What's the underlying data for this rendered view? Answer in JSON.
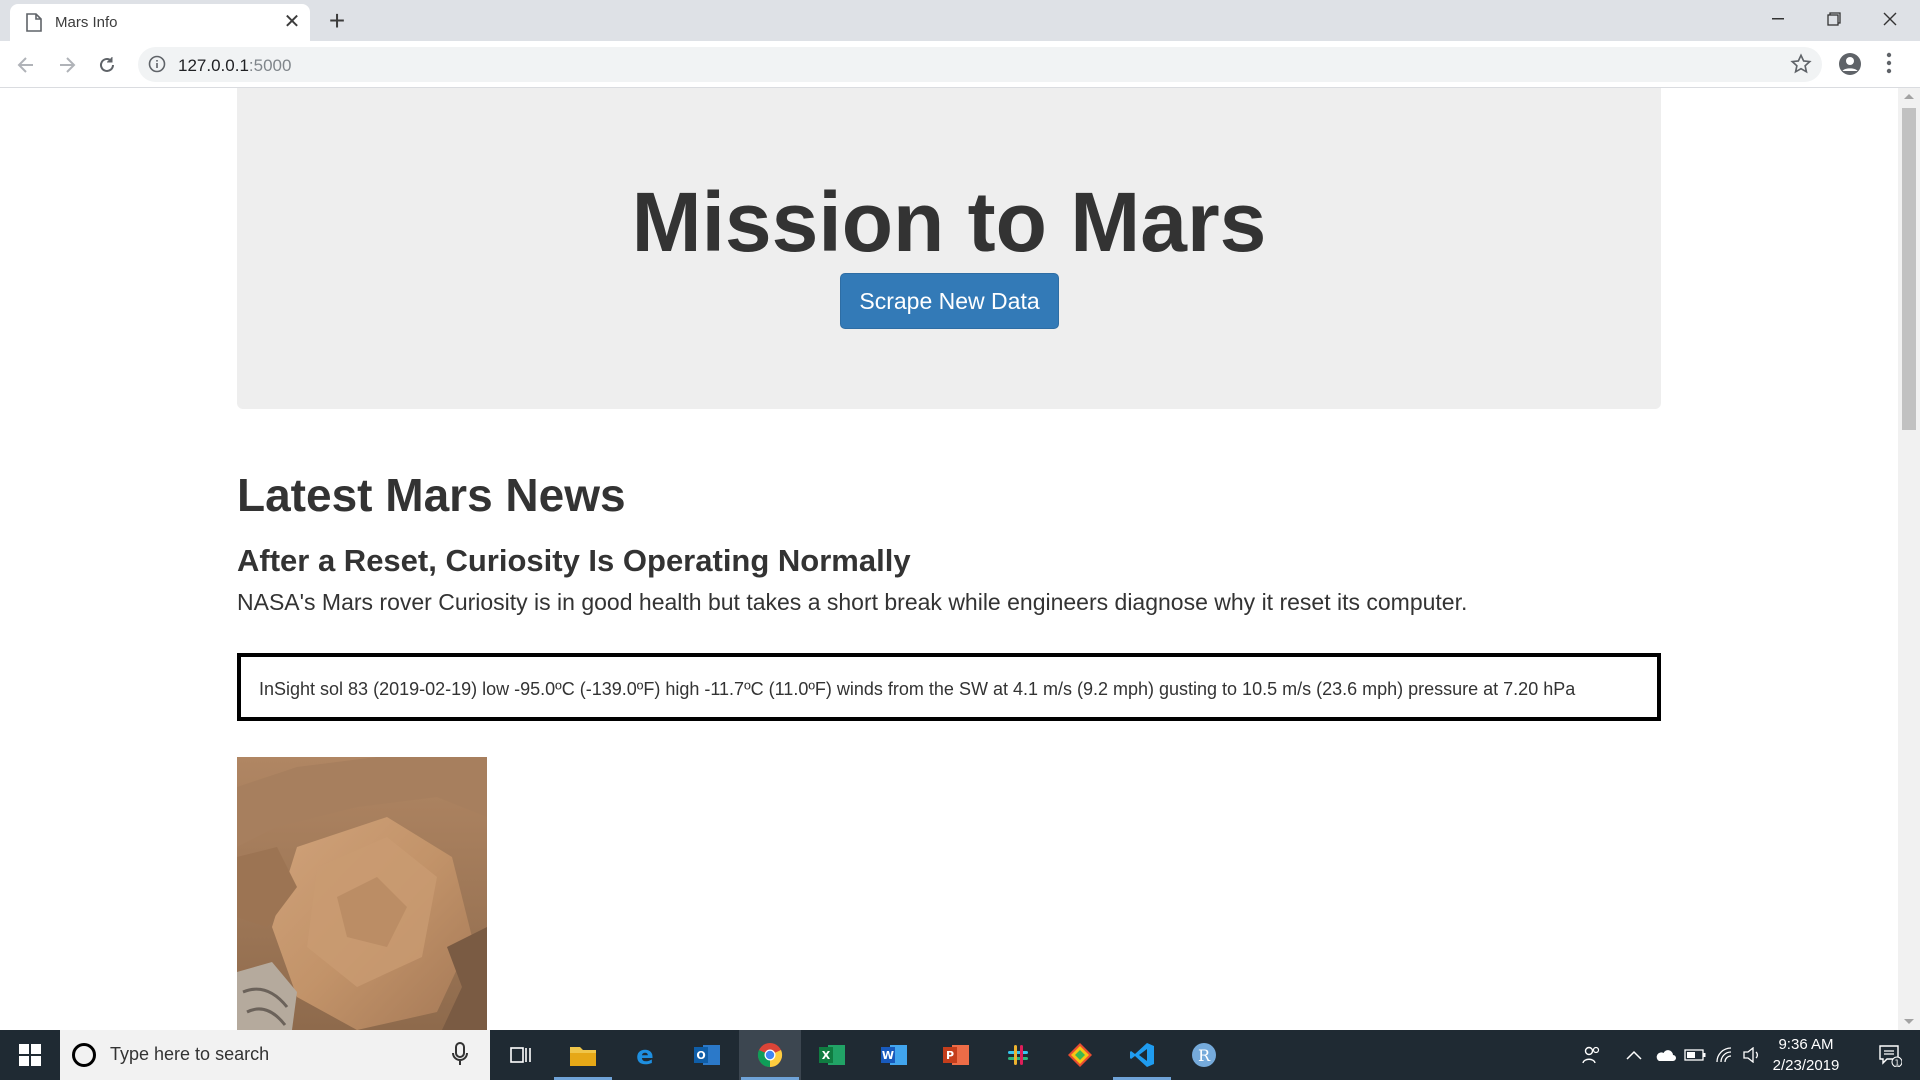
{
  "browser": {
    "tab_title": "Mars Info",
    "url_host": "127.0.0.1",
    "url_port": ":5000"
  },
  "page": {
    "jumbotron_title": "Mission to Mars",
    "scrape_button": "Scrape New Data",
    "news_heading": "Latest Mars News",
    "news_title": "After a Reset, Curiosity Is Operating Normally",
    "news_paragraph": "NASA's Mars rover Curiosity is in good health but takes a short break while engineers diagnose why it reset its computer.",
    "weather": "InSight sol 83 (2019-02-19) low -95.0ºC (-139.0ºF) high -11.7ºC (11.0ºF) winds from the SW at 4.1 m/s (9.2 mph) gusting to 10.5 m/s (23.6 mph) pressure at 7.20 hPa"
  },
  "taskbar": {
    "search_placeholder": "Type here to search",
    "time": "9:36 AM",
    "date": "2/23/2019",
    "notification_count": "1"
  },
  "colors": {
    "primary_button": "#337ab7",
    "jumbotron_bg": "#eeeeee",
    "taskbar_bg": "#1f2a33"
  }
}
